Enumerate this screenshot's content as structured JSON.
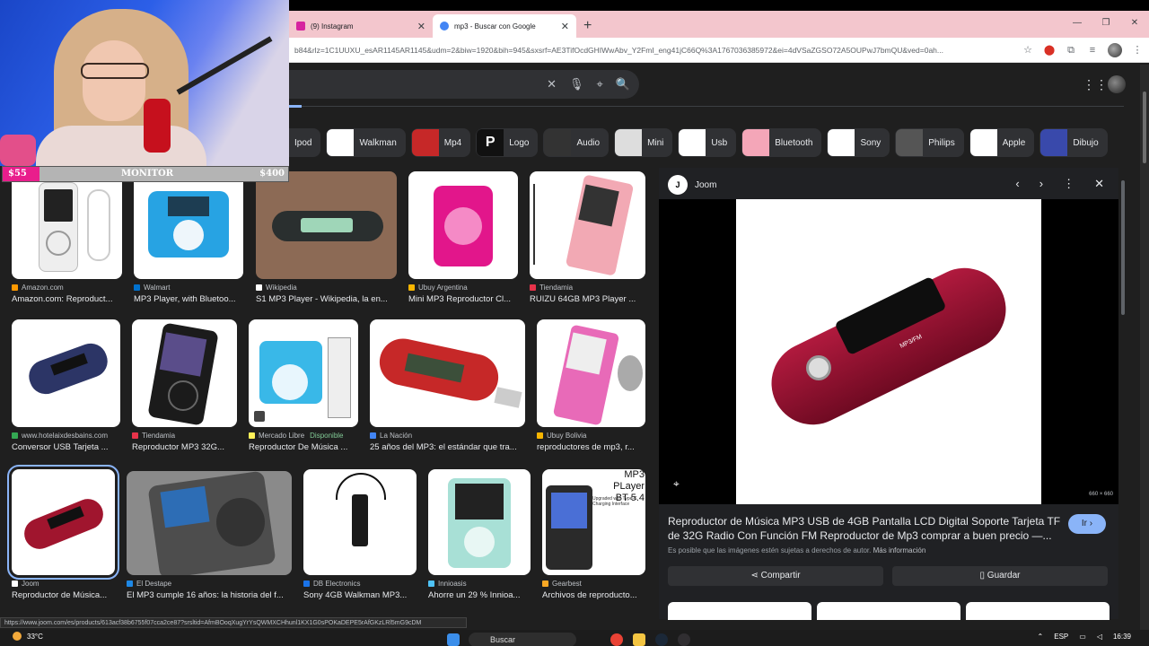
{
  "browser": {
    "tabs": [
      {
        "title": "(9) Instagram",
        "active": false,
        "icon_color": "#d6249f"
      },
      {
        "title": "mp3 - Buscar con Google",
        "active": true,
        "icon_color": "#4285f4"
      }
    ],
    "url": "b84&rlz=1C1UUXU_esAR1145AR1145&udm=2&biw=1920&bih=945&sxsrf=AE3TifOcdGHIWwAbv_Y2FmI_eng41jC66Q%3A1767036385972&ei=4dVSaZGSO72A5OUPwJ7bmQU&ved=0ah...",
    "status_url": "https://www.joom.com/es/products/613acf38b6755f07cca2ce87?srsltid=AfmBOoqXugYrYsQWMXCHhunl1KX1G0sPOKaDEPE5rAfGKzLRl5mG9cDM"
  },
  "search": {
    "clear": "✕",
    "mic": "🎙",
    "lens": "⌖",
    "go": "🔍"
  },
  "chips": [
    {
      "label": "Ipod"
    },
    {
      "label": "Walkman"
    },
    {
      "label": "Mp4"
    },
    {
      "label": "Logo"
    },
    {
      "label": "Audio"
    },
    {
      "label": "Mini"
    },
    {
      "label": "Usb"
    },
    {
      "label": "Bluetooth"
    },
    {
      "label": "Sony"
    },
    {
      "label": "Philips"
    },
    {
      "label": "Apple"
    },
    {
      "label": "Dibujo"
    }
  ],
  "results": [
    {
      "source": "Amazon.com",
      "title": "Amazon.com: Reproduct...",
      "color": "#ff9900"
    },
    {
      "source": "Walmart",
      "title": "MP3 Player, with Bluetoo...",
      "color": "#0071ce"
    },
    {
      "source": "Wikipedia",
      "title": "S1 MP3 Player - Wikipedia, la en...",
      "color": "#ffffff"
    },
    {
      "source": "Ubuy Argentina",
      "title": "Mini MP3 Reproductor Cl...",
      "color": "#f7b500"
    },
    {
      "source": "Tiendamia",
      "title": "RUIZU 64GB MP3 Player ...",
      "color": "#e8334a"
    },
    {
      "source": "www.hotelaixdesbains.com",
      "title": "Conversor USB Tarjeta ...",
      "color": "#34a853"
    },
    {
      "source": "Tiendamia",
      "title": "Reproductor MP3 32G...",
      "color": "#e8334a"
    },
    {
      "source": "Mercado Libre",
      "title": "Reproductor De Música ...",
      "color": "#fff159",
      "badge": "Disponible"
    },
    {
      "source": "La Nación",
      "title": "25 años del MP3: el estándar que tra...",
      "color": "#4285f4"
    },
    {
      "source": "Ubuy Bolivia",
      "title": "reproductores de mp3, r...",
      "color": "#f7b500"
    },
    {
      "source": "Joom",
      "title": "Reproductor de Música...",
      "color": "#ffffff"
    },
    {
      "source": "El Destape",
      "title": "El MP3 cumple 16 años: la historia del f...",
      "color": "#1e88e5"
    },
    {
      "source": "DB Electronics",
      "title": "Sony 4GB Walkman MP3...",
      "color": "#1a73e8"
    },
    {
      "source": "Innioasis",
      "title": "Ahorre un 29 % Innioa...",
      "color": "#4fc3f7"
    },
    {
      "source": "Gearbest",
      "title": "Archivos de reproducto...",
      "color": "#f9a825"
    }
  ],
  "thumb_overlay": {
    "mp3_text": "MP3 PLayer\nBT 5.4",
    "charging": "Upgraded with Type-C\nCharging Interface"
  },
  "preview": {
    "site": "Joom",
    "site_logo": "J",
    "title": "Reproductor de Música MP3 USB de 4GB Pantalla LCD Digital Soporte Tarjeta TF de 32G Radio Con Función FM Reproductor de Mp3 comprar a buen precio —...",
    "go_label": "Ir ›",
    "note": "Es posible que las imágenes estén sujetas a derechos de autor.",
    "more_info": "Más información",
    "share_label": "Compartir",
    "save_label": "Guardar",
    "dimensions": "660 × 660",
    "device_text_1": "DIGITAL MP3 PLAYER",
    "device_text_2": "MP3/FM"
  },
  "overlay": {
    "monitor_label": "MONITOR",
    "min_amount": "$55",
    "max_amount": "$400",
    "progress_fraction": 0.13
  },
  "taskbar": {
    "weather_temp": "33°C",
    "search_placeholder": "Buscar",
    "lang": "ESP",
    "time": "16:39"
  }
}
